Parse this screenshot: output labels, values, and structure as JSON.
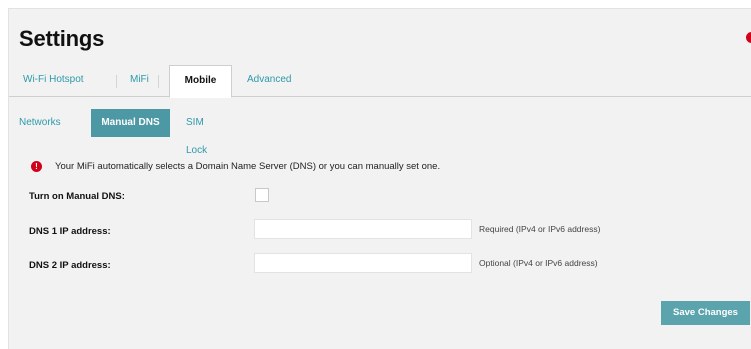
{
  "page": {
    "title": "Settings"
  },
  "tabs": [
    {
      "label": "Wi-Fi Hotspot",
      "active": false
    },
    {
      "label": "MiFi",
      "active": false
    },
    {
      "label": "Mobile",
      "active": true
    },
    {
      "label": "Advanced",
      "active": false
    }
  ],
  "subtabs": [
    {
      "label": "Networks",
      "active": false
    },
    {
      "label": "Manual DNS",
      "active": true
    },
    {
      "label": "SIM Lock",
      "active": false
    }
  ],
  "info": {
    "icon": "info-icon",
    "text": "Your MiFi automatically selects a Domain Name Server (DNS) or you can manually set one."
  },
  "form": {
    "manual_dns_label": "Turn on Manual DNS:",
    "manual_dns_checked": false,
    "dns1_label": "DNS 1 IP address:",
    "dns1_value": "",
    "dns1_hint": "Required (IPv4 or IPv6 address)",
    "dns2_label": "DNS 2 IP address:",
    "dns2_value": "",
    "dns2_hint": "Optional (IPv4 or IPv6 address)",
    "save_label": "Save Changes"
  },
  "colors": {
    "accent": "#2e9aa8",
    "active_subtab": "#4c98a4",
    "button": "#5ba4ad",
    "alert": "#d0021b"
  }
}
